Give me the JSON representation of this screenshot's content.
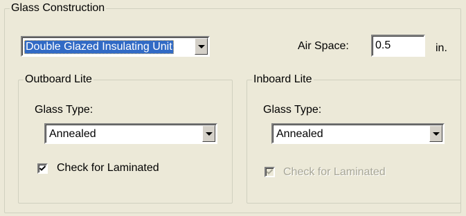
{
  "glass_construction": {
    "title": "Glass Construction",
    "construction_type": {
      "selected": "Double Glazed Insulating Unit"
    },
    "air_space": {
      "label": "Air Space:",
      "value": "0.5",
      "unit": "in."
    }
  },
  "outboard_lite": {
    "title": "Outboard Lite",
    "glass_type_label": "Glass Type:",
    "glass_type_selected": "Annealed",
    "laminated_label": "Check for Laminated",
    "laminated_checked": true,
    "laminated_enabled": true
  },
  "inboard_lite": {
    "title": "Inboard Lite",
    "glass_type_label": "Glass Type:",
    "glass_type_selected": "Annealed",
    "laminated_label": "Check for Laminated",
    "laminated_checked": true,
    "laminated_enabled": false
  },
  "icons": {
    "dropdown": "chevron-down-icon",
    "check": "checkmark-icon"
  },
  "colors": {
    "background": "#ece9d8",
    "selection": "#316ac5",
    "disabled_text": "#a7a697"
  }
}
